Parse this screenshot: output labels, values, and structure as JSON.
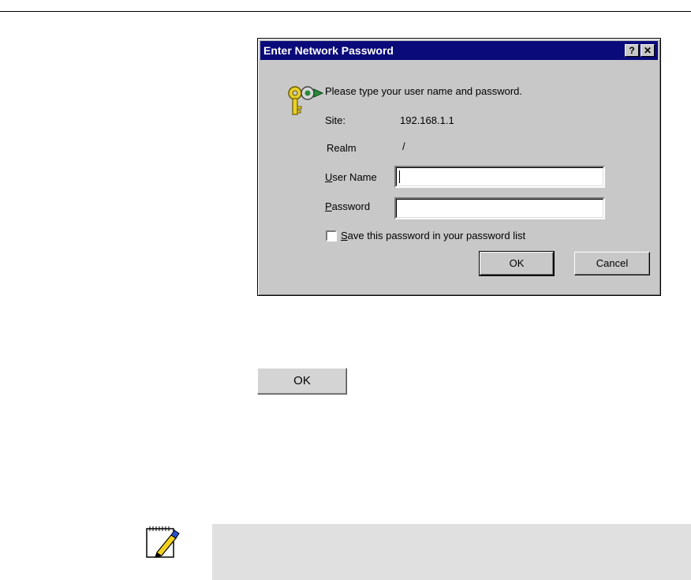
{
  "dialog": {
    "title": "Enter Network Password",
    "help_button": "?",
    "close_button": "✕",
    "prompt": "Please type your user name and password.",
    "site_label": "Site:",
    "site_value": "192.168.1.1",
    "realm_label": "Realm",
    "realm_value": "/",
    "username": {
      "label_accel": "U",
      "label_rest": "ser Name",
      "value": ""
    },
    "password": {
      "label_accel": "P",
      "label_rest": "assword",
      "value": ""
    },
    "save_password": {
      "accel": "S",
      "rest": "ave this password in your password list",
      "checked": false
    },
    "ok_label": "OK",
    "cancel_label": "Cancel"
  },
  "standalone_button": {
    "label": "OK"
  },
  "icons": {
    "key": "key-icon",
    "note": "note-pencil-icon"
  },
  "colors": {
    "titlebar": "#0a0a7a",
    "dialog_bg": "#c8c8c8",
    "note_bg": "#e0e0e0"
  }
}
